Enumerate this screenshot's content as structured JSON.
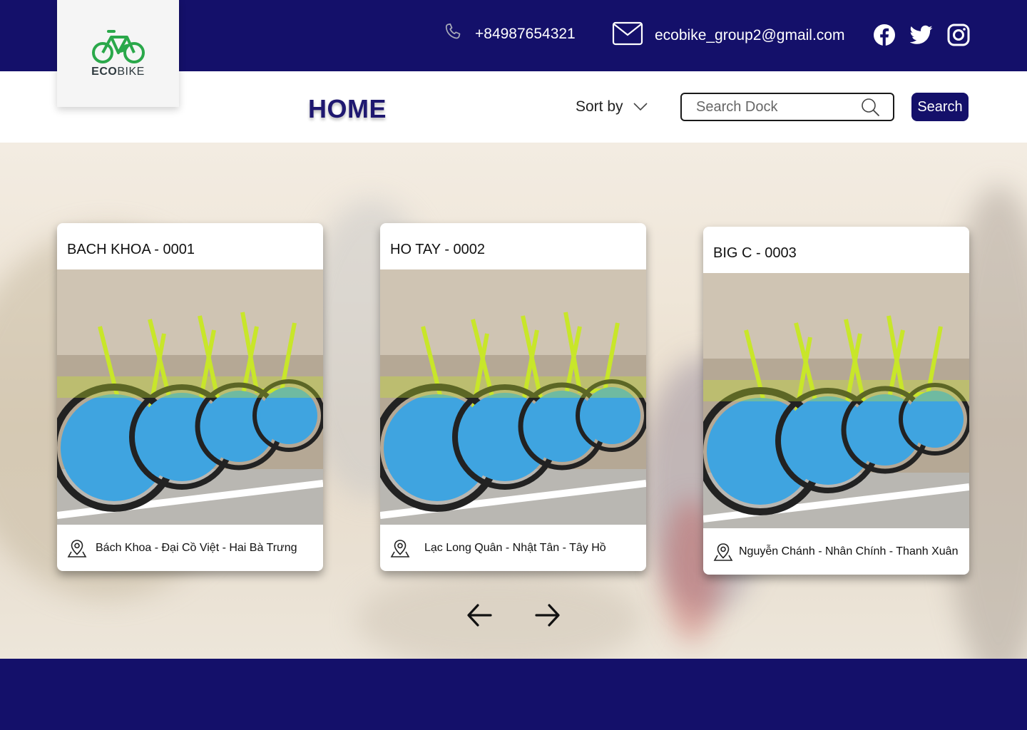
{
  "app": {
    "logo_text_eco": "ECO",
    "logo_text_bike": "BIKE"
  },
  "header": {
    "phone": "+84987654321",
    "email": "ecobike_group2@gmail.com",
    "icons": [
      "phone-icon",
      "mail-icon",
      "facebook-icon",
      "twitter-icon",
      "instagram-icon"
    ]
  },
  "nav": {
    "title": "HOME",
    "sort_label": "Sort by",
    "search_placeholder": "Search Dock",
    "search_button": "Search"
  },
  "docks": [
    {
      "title": "BACH KHOA - 0001",
      "address": "Bách Khoa - Đại Cồ Việt - Hai Bà Trưng"
    },
    {
      "title": "HO TAY - 0002",
      "address": "Lạc Long Quân - Nhật Tân - Tây Hồ"
    },
    {
      "title": "BIG C - 0003",
      "address": "Nguyễn Chánh - Nhân Chính - Thanh Xuân"
    }
  ],
  "carousel": {
    "prev_icon": "arrow-left-icon",
    "next_icon": "arrow-right-icon"
  },
  "colors": {
    "primary": "#14106a",
    "bike_frame": "#c8e62a",
    "wheel_guard": "#3fa4e0",
    "logo_green": "#2aa84a"
  }
}
